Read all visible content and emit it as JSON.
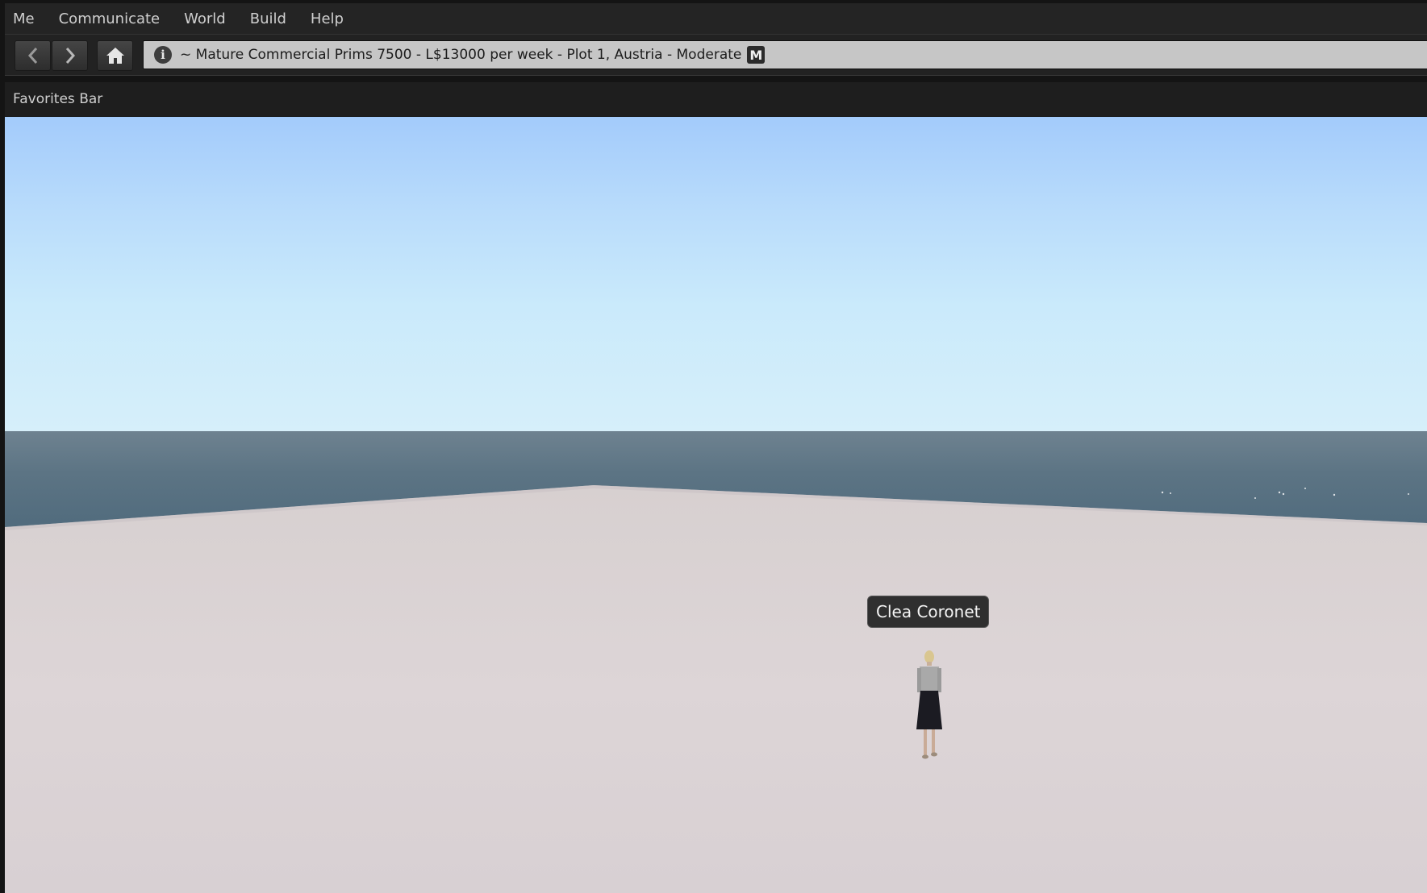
{
  "menu": {
    "items": [
      {
        "label": "Me"
      },
      {
        "label": "Communicate"
      },
      {
        "label": "World"
      },
      {
        "label": "Build"
      },
      {
        "label": "Help"
      }
    ]
  },
  "navbar": {
    "back_icon": "chevron-left-icon",
    "forward_icon": "chevron-right-icon",
    "home_icon": "home-icon",
    "info_icon_glyph": "i",
    "location": "~ Mature Commercial Prims 7500 - L$13000 per week - Plot 1, Austria - Moderate",
    "maturity_badge": "M"
  },
  "favorites_bar": {
    "label": "Favorites Bar"
  },
  "world": {
    "avatar_name": "Clea Coronet",
    "colors": {
      "sky_top": "#a3cbfb",
      "sky_horizon": "#d6effa",
      "sea": "#5c7484",
      "ground": "#dcd4d6"
    }
  }
}
